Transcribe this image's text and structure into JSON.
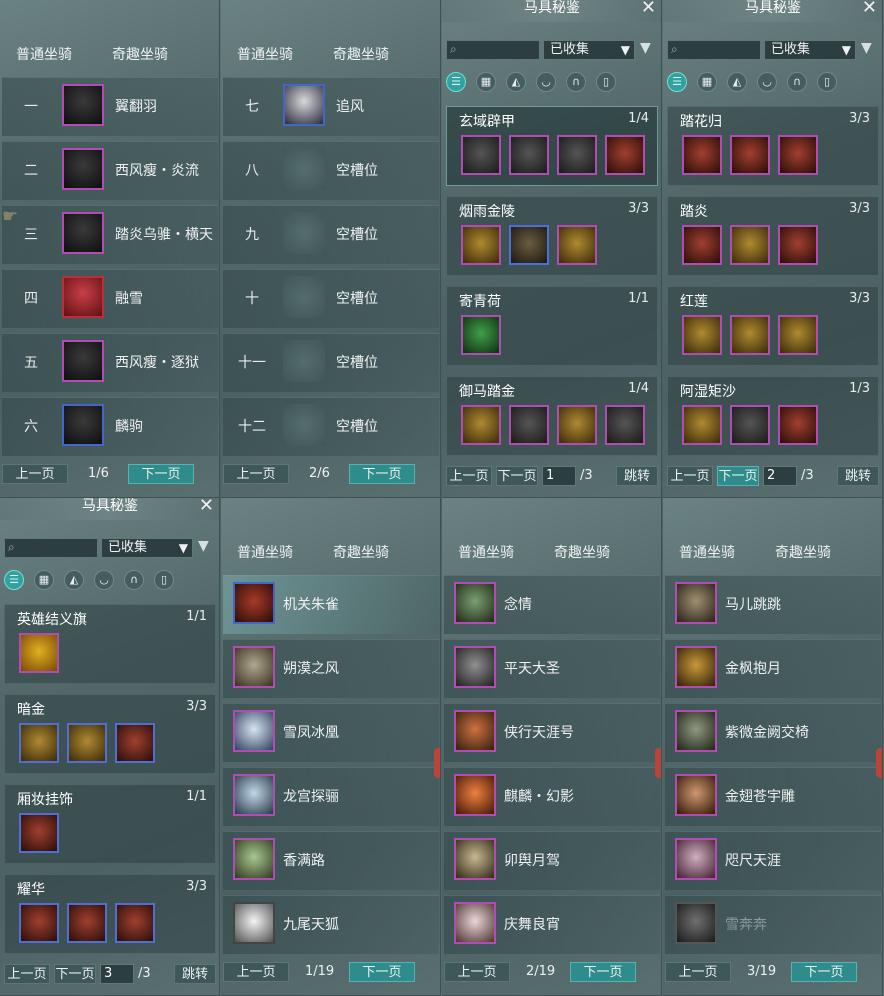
{
  "tabs": {
    "normal": "普通坐骑",
    "fun": "奇趣坐骑"
  },
  "pager": {
    "prev": "上一页",
    "next": "下一页",
    "jump": "跳转",
    "total_sep": "/3"
  },
  "window": {
    "title": "马具秘鉴",
    "close": "✕",
    "filter_value": "已收集"
  },
  "panel1": {
    "rows": [
      {
        "num": "一",
        "name": "翼翻羽"
      },
      {
        "num": "二",
        "name": "西风瘦・炎流"
      },
      {
        "num": "三",
        "name": "踏炎乌骓・横天"
      },
      {
        "num": "四",
        "name": "融雪"
      },
      {
        "num": "五",
        "name": "西风瘦・逐狱"
      },
      {
        "num": "六",
        "name": "麟驹"
      }
    ],
    "page": "1/6"
  },
  "panel2": {
    "rows": [
      {
        "num": "七",
        "name": "追风"
      },
      {
        "num": "八",
        "name": "空槽位"
      },
      {
        "num": "九",
        "name": "空槽位"
      },
      {
        "num": "十",
        "name": "空槽位"
      },
      {
        "num": "十一",
        "name": "空槽位"
      },
      {
        "num": "十二",
        "name": "空槽位"
      }
    ],
    "page": "2/6"
  },
  "panel3": {
    "sets": [
      {
        "name": "玄域辟甲",
        "count": "1/4"
      },
      {
        "name": "烟雨金陵",
        "count": "3/3"
      },
      {
        "name": "寄青荷",
        "count": "1/1"
      },
      {
        "name": "御马踏金",
        "count": "1/4"
      }
    ],
    "page_input": "1"
  },
  "panel4": {
    "sets": [
      {
        "name": "踏花归",
        "count": "3/3"
      },
      {
        "name": "踏炎",
        "count": "3/3"
      },
      {
        "name": "红莲",
        "count": "3/3"
      },
      {
        "name": "阿湿矩沙",
        "count": "1/3"
      }
    ],
    "page_input": "2"
  },
  "panel5": {
    "sets": [
      {
        "name": "英雄结义旗",
        "count": "1/1"
      },
      {
        "name": "暗金",
        "count": "3/3"
      },
      {
        "name": "厢妆挂饰",
        "count": "1/1"
      },
      {
        "name": "耀华",
        "count": "3/3"
      }
    ],
    "page_input": "3"
  },
  "panel6": {
    "rows": [
      {
        "name": "机关朱雀"
      },
      {
        "name": "朔漠之风"
      },
      {
        "name": "雪凤冰凰"
      },
      {
        "name": "龙宫探骊"
      },
      {
        "name": "香满路"
      },
      {
        "name": "九尾天狐"
      }
    ],
    "page": "1/19"
  },
  "panel7": {
    "rows": [
      {
        "name": "念情"
      },
      {
        "name": "平天大圣"
      },
      {
        "name": "侠行天涯号"
      },
      {
        "name": "麒麟・幻影"
      },
      {
        "name": "卯舆月驾"
      },
      {
        "name": "庆舞良宵"
      }
    ],
    "page": "2/19"
  },
  "panel8": {
    "rows": [
      {
        "name": "马儿跳跳"
      },
      {
        "name": "金枫抱月"
      },
      {
        "name": "紫微金阙交椅"
      },
      {
        "name": "金翅苍宇雕"
      },
      {
        "name": "咫尺天涯"
      },
      {
        "name": "雪奔奔"
      }
    ],
    "page": "3/19"
  },
  "colors": {
    "accent": "#2f8c8c",
    "rare_border": "#b04db2",
    "blue_border": "#4466c8"
  }
}
